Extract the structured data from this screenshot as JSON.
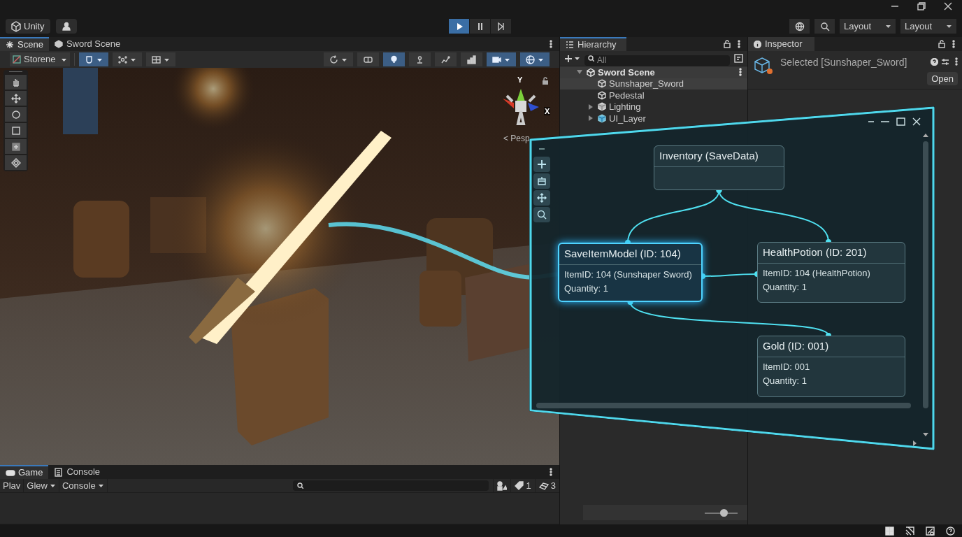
{
  "toolbar": {
    "unity_label": "Unity",
    "play_controls": [
      {
        "selected": true
      },
      {
        "selected": false
      },
      {
        "selected": false
      }
    ],
    "layout_dropdowns": [
      "Layout",
      "Layout"
    ]
  },
  "scene_panel": {
    "tabs": [
      {
        "label": "Scene",
        "selected": true
      },
      {
        "label": "Sword Scene",
        "selected": false
      }
    ],
    "shading": "Storene",
    "buttons": [
      {
        "on": true,
        "dropdown": true
      },
      {
        "on": false,
        "dropdown": true
      },
      {
        "on": false,
        "dropdown": true
      },
      {
        "on": false,
        "dropdown": true
      },
      {
        "on": false,
        "dropdown": false
      },
      {
        "on": true,
        "dropdown": false
      },
      {
        "on": false,
        "dropdown": false
      },
      {
        "on": false,
        "dropdown": false
      },
      {
        "on": false,
        "dropdown": false
      },
      {
        "on": true,
        "dropdown": true
      },
      {
        "on": true,
        "dropdown": true
      }
    ],
    "tools": [
      {
        "selected": false
      },
      {
        "selected": false
      },
      {
        "selected": false
      },
      {
        "selected": false
      },
      {
        "selected": false
      },
      {
        "selected": false
      }
    ],
    "gizmo_axes": [
      "Y",
      "X"
    ],
    "projection": "< Pesp"
  },
  "hierarchy": {
    "title": "Hierarchy",
    "search_placeholder": "All",
    "items": [
      {
        "label": "Sword Scene",
        "kind": "scene",
        "expanded": true,
        "children": [
          {
            "label": "Sunshaper_Sword",
            "kind": "object",
            "selected": true
          },
          {
            "label": "Pedestal",
            "kind": "object",
            "selected": false
          },
          {
            "label": "Lighting",
            "kind": "prefab",
            "selected": false,
            "expanded": false
          },
          {
            "label": "UI_Layer",
            "kind": "ui_prefab",
            "selected": false,
            "expanded": false
          }
        ]
      }
    ],
    "zoom_slider": {
      "level": 0.62
    }
  },
  "inspector": {
    "title": "Inspector",
    "selection": "Selected [Sunshaper_Sword]",
    "open_button": "Open"
  },
  "graph_window": {
    "nodes": [
      {
        "title": "Inventory (SaveData)",
        "selected": false
      },
      {
        "title": "SaveItemModel (ID: 104)",
        "lines": [
          "ItemID: 104 (Sunshaper Sword)",
          "Quantity: 1"
        ],
        "selected": true
      },
      {
        "title": "HealthPotion (ID: 201)",
        "lines": [
          "ItemID: 104 (HealthPotion)",
          "Quantity: 1"
        ],
        "selected": false
      },
      {
        "title": "Gold (ID: 001)",
        "lines": [
          "ItemID: 001",
          "Quantity: 1"
        ],
        "selected": false
      }
    ]
  },
  "bottom_panel": {
    "tabs": [
      {
        "label": "Game",
        "selected": true
      },
      {
        "label": "Console",
        "selected": false
      }
    ],
    "buttons": [
      {
        "label": "Plav",
        "dropdown": false
      },
      {
        "label": "Glew",
        "dropdown": true
      },
      {
        "label": "Console",
        "dropdown": true
      }
    ],
    "warning_count": "1",
    "message_count": "3"
  }
}
